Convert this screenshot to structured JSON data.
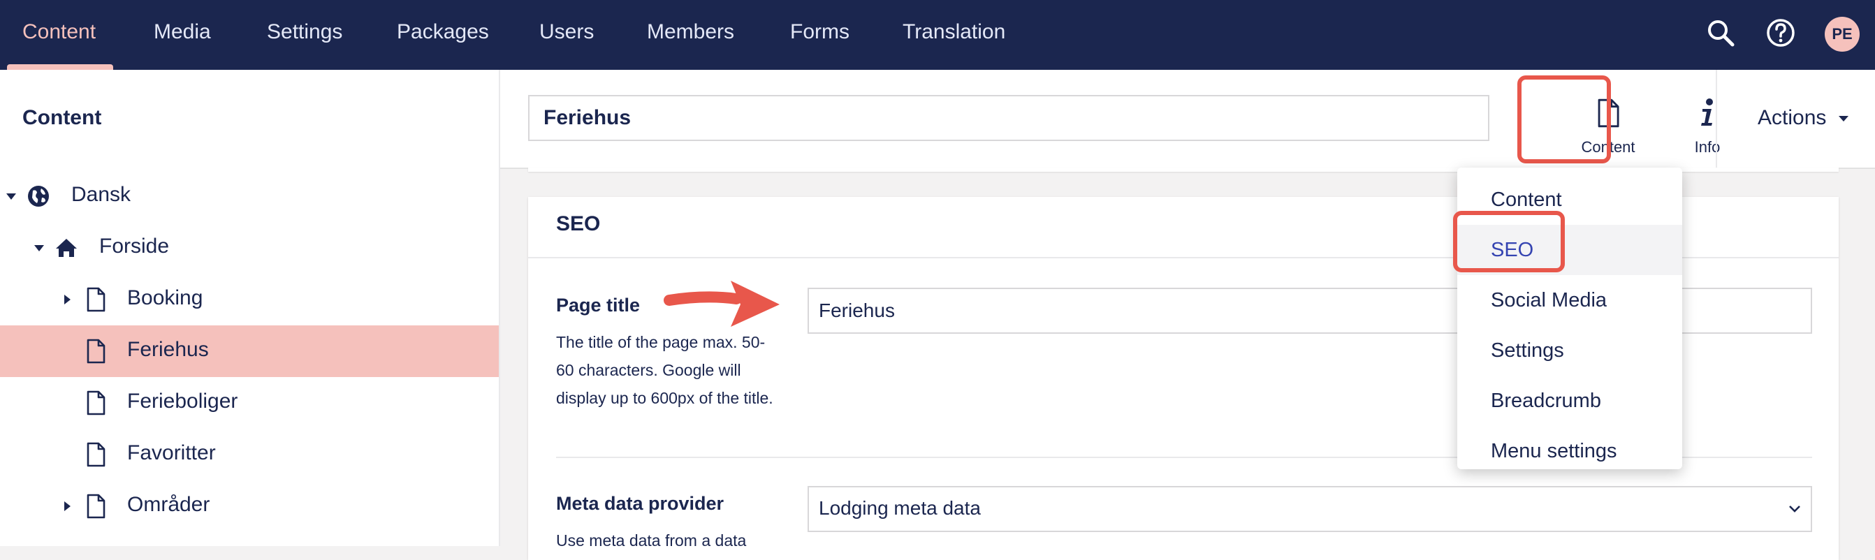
{
  "top_nav": {
    "items": [
      {
        "label": "Content",
        "active": true
      },
      {
        "label": "Media"
      },
      {
        "label": "Settings"
      },
      {
        "label": "Packages"
      },
      {
        "label": "Users"
      },
      {
        "label": "Members"
      },
      {
        "label": "Forms"
      },
      {
        "label": "Translation"
      }
    ],
    "icons": [
      "search-icon",
      "help-icon"
    ],
    "avatar_initials": "PE",
    "colors": {
      "background": "#1b264f",
      "active": "#f5c1bc",
      "text": "#e4e8f7"
    }
  },
  "sidebar": {
    "title": "Content",
    "tree": [
      {
        "label": "Dansk",
        "icon": "globe-icon",
        "expanded": true
      },
      {
        "label": "Forside",
        "icon": "home-icon",
        "expanded": true
      },
      {
        "label": "Booking",
        "icon": "document-icon",
        "has_children": true
      },
      {
        "label": "Feriehus",
        "icon": "document-icon",
        "selected": true
      },
      {
        "label": "Ferieboliger",
        "icon": "document-icon"
      },
      {
        "label": "Favoritter",
        "icon": "document-icon"
      },
      {
        "label": "Områder",
        "icon": "document-icon",
        "has_children": true
      }
    ],
    "selected_color": "#f5c1bc"
  },
  "editor": {
    "node_name": "Feriehus",
    "apps": [
      {
        "label": "Content",
        "icon": "document-icon",
        "active": true
      },
      {
        "label": "Info",
        "icon": "info-icon"
      }
    ],
    "actions_label": "Actions"
  },
  "seo_panel": {
    "title": "SEO",
    "page_title": {
      "label": "Page title",
      "description": "The title of the page max. 50-60 characters. Google will display up to 600px of the title.",
      "value": "Feriehus"
    },
    "meta_provider": {
      "label": "Meta data provider",
      "description": "Use meta data from a data",
      "value": "Lodging meta data"
    }
  },
  "tab_dropdown": {
    "items": [
      {
        "label": "Content"
      },
      {
        "label": "SEO",
        "active": true
      },
      {
        "label": "Social Media"
      },
      {
        "label": "Settings"
      },
      {
        "label": "Breadcrumb"
      },
      {
        "label": "Menu settings"
      }
    ]
  },
  "annotation_color": "#e8574b"
}
